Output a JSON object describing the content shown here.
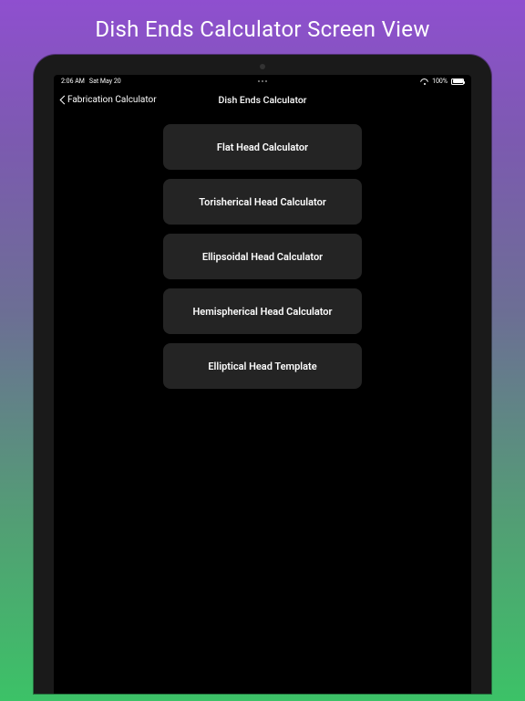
{
  "promo": {
    "title": "Dish Ends Calculator Screen View"
  },
  "status": {
    "time": "2:06 AM",
    "date": "Sat May 20",
    "battery_pct": "100%"
  },
  "nav": {
    "back_label": "Fabrication Calculator",
    "title": "Dish Ends Calculator"
  },
  "menu": {
    "items": [
      {
        "label": "Flat Head Calculator"
      },
      {
        "label": "Torisherical Head Calculator"
      },
      {
        "label": "Ellipsoidal Head Calculator"
      },
      {
        "label": "Hemispherical Head Calculator"
      },
      {
        "label": "Elliptical Head Template"
      }
    ]
  }
}
